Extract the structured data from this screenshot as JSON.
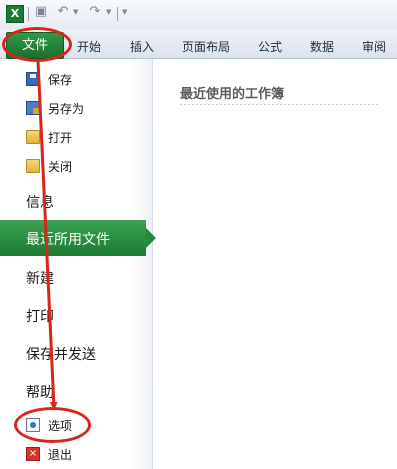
{
  "quick_access": {
    "app_icon": "excel-icon",
    "save_icon": "save-icon",
    "undo_icon": "undo-icon",
    "redo_icon": "redo-icon",
    "customize_icon": "customize-icon"
  },
  "ribbon": {
    "file_tab": "文件",
    "tabs": [
      "开始",
      "插入",
      "页面布局",
      "公式",
      "数据",
      "审阅"
    ]
  },
  "backstage": {
    "commands": [
      {
        "label": "保存",
        "icon": "save-icon"
      },
      {
        "label": "另存为",
        "icon": "save-as-icon"
      },
      {
        "label": "打开",
        "icon": "folder-open-icon"
      },
      {
        "label": "关闭",
        "icon": "folder-close-icon"
      }
    ],
    "sections": {
      "info": "信息",
      "recent": "最近所用文件",
      "new": "新建",
      "print": "打印",
      "save_send": "保存并发送",
      "help": "帮助"
    },
    "bottom_commands": [
      {
        "label": "选项",
        "icon": "options-icon"
      },
      {
        "label": "退出",
        "icon": "exit-icon"
      }
    ]
  },
  "content": {
    "title": "最近使用的工作簿"
  },
  "annotation": {
    "color": "#d9261c"
  }
}
